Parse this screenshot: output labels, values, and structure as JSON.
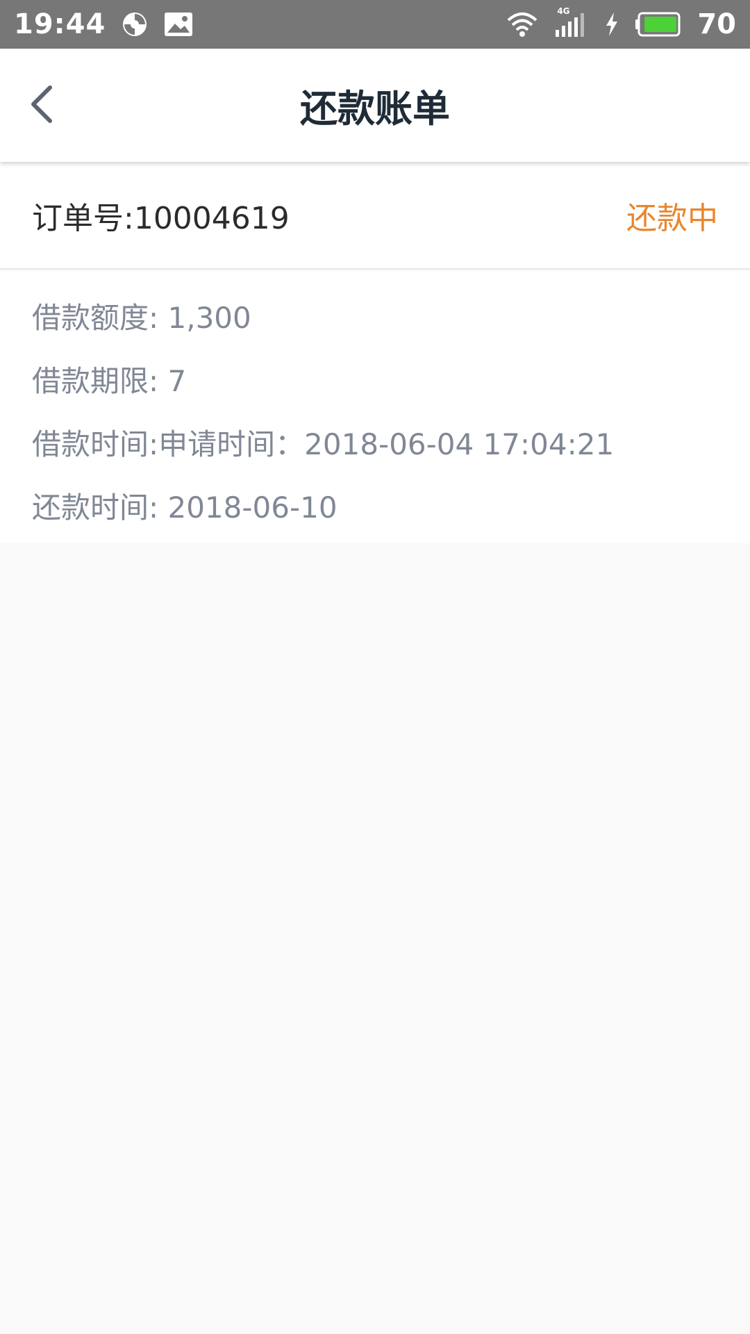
{
  "status_bar": {
    "time": "19:44",
    "battery_percent": "70",
    "network_label": "4G",
    "icons": [
      "vpn-sync-icon",
      "image-notification-icon",
      "wifi-icon",
      "signal-icon",
      "charging-icon",
      "battery-icon"
    ]
  },
  "header": {
    "title": "还款账单",
    "back_icon": "chevron-left-icon"
  },
  "order": {
    "number_label": "订单号:10004619",
    "status": "还款中"
  },
  "details": [
    {
      "text": "借款额度: 1,300"
    },
    {
      "text": "借款期限: 7"
    },
    {
      "text": "借款时间:申请时间：2018-06-04 17:04:21"
    },
    {
      "text": "还款时间: 2018-06-10"
    }
  ],
  "colors": {
    "status_bar_bg": "#777777",
    "accent_orange": "#e9862d",
    "title_text": "#1f2b37",
    "detail_text": "#808795",
    "page_bg": "#f9f9f9",
    "battery_fill": "#4cd137"
  }
}
